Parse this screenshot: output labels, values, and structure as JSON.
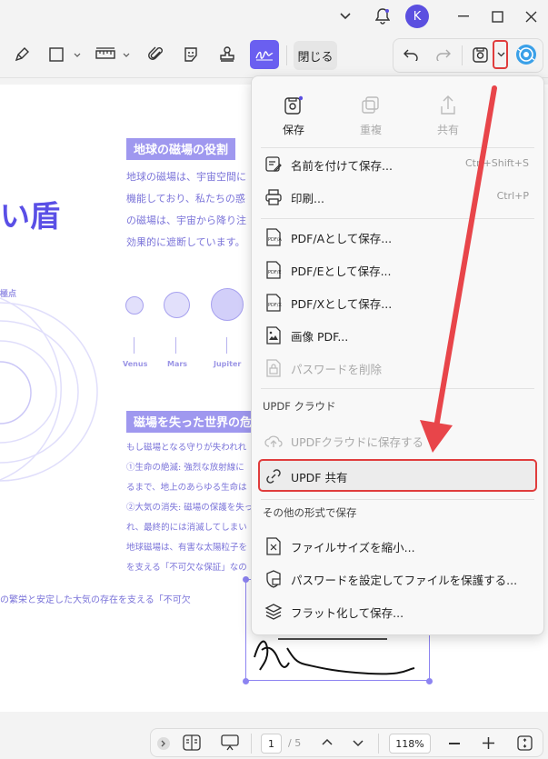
{
  "window": {
    "avatar_letter": "K",
    "accent_color": "#5b4fe0"
  },
  "toolbar": {
    "close_label": "閉じる",
    "icons": [
      "pen-icon",
      "rectangle-icon",
      "chevron-down-icon",
      "ruler-icon",
      "chevron-down-icon",
      "paperclip-icon",
      "sticker-icon",
      "stamp-icon",
      "signature-icon",
      "undo-icon",
      "redo-icon",
      "save-icon",
      "chevron-down-icon",
      "ai-assistant-icon"
    ]
  },
  "document": {
    "title_fragment": "い盾",
    "heading1": "地球の磁場の役割",
    "para1": [
      "地球の磁場は、宇宙空間に",
      "機能しており、私たちの惑",
      "の磁場は、宇宙から降り注",
      "効果的に遮断しています。"
    ],
    "pole_label": "極点",
    "planets": [
      "Venus",
      "Mars",
      "Jupiter"
    ],
    "heading2": "磁場を失った世界の危",
    "para2": [
      "もし磁場となる守りが失われれ",
      "①生命の絶滅: 強烈な放射線に",
      "るまで、地上のあらゆる生命は",
      "②大気の消失: 磁場の保護を失っ",
      "れ、最終的には消滅してしまい",
      "地球磁場は、有害な太陽粒子を",
      "を支える「不可欠な保証」なの"
    ],
    "bottom_line": "の繁栄と安定した大気の存在を支える「不可欠"
  },
  "menu": {
    "quick_actions": [
      {
        "label": "保存",
        "icon": "save-icon",
        "enabled": true
      },
      {
        "label": "重複",
        "icon": "duplicate-icon",
        "enabled": false
      },
      {
        "label": "共有",
        "icon": "share-icon",
        "enabled": false
      }
    ],
    "items": [
      {
        "label": "名前を付けて保存...",
        "shortcut": "Ctrl+Shift+S",
        "icon": "save-as-icon"
      },
      {
        "label": "印刷...",
        "shortcut": "Ctrl+P",
        "icon": "print-icon"
      },
      {
        "label": "PDF/Aとして保存...",
        "icon": "pdf-a-icon"
      },
      {
        "label": "PDF/Eとして保存...",
        "icon": "pdf-e-icon"
      },
      {
        "label": "PDF/Xとして保存...",
        "icon": "pdf-x-icon"
      },
      {
        "label": "画像 PDF...",
        "icon": "image-pdf-icon"
      },
      {
        "label": "パスワードを削除",
        "icon": "remove-password-icon",
        "disabled": true
      }
    ],
    "cloud_section": "UPDF クラウド",
    "cloud_items": [
      {
        "label": "UPDFクラウドに保存する",
        "icon": "cloud-upload-icon",
        "disabled": true
      },
      {
        "label": "UPDF 共有",
        "icon": "link-icon"
      }
    ],
    "other_section": "その他の形式で保存",
    "other_items": [
      {
        "label": "ファイルサイズを縮小...",
        "icon": "compress-icon"
      },
      {
        "label": "パスワードを設定してファイルを保護する...",
        "icon": "protect-icon"
      },
      {
        "label": "フラット化して保存...",
        "icon": "flatten-icon"
      }
    ],
    "highlight_color": "#e03d3d"
  },
  "bottombar": {
    "page_current": "1",
    "page_total": "/ 5",
    "zoom": "118%"
  }
}
